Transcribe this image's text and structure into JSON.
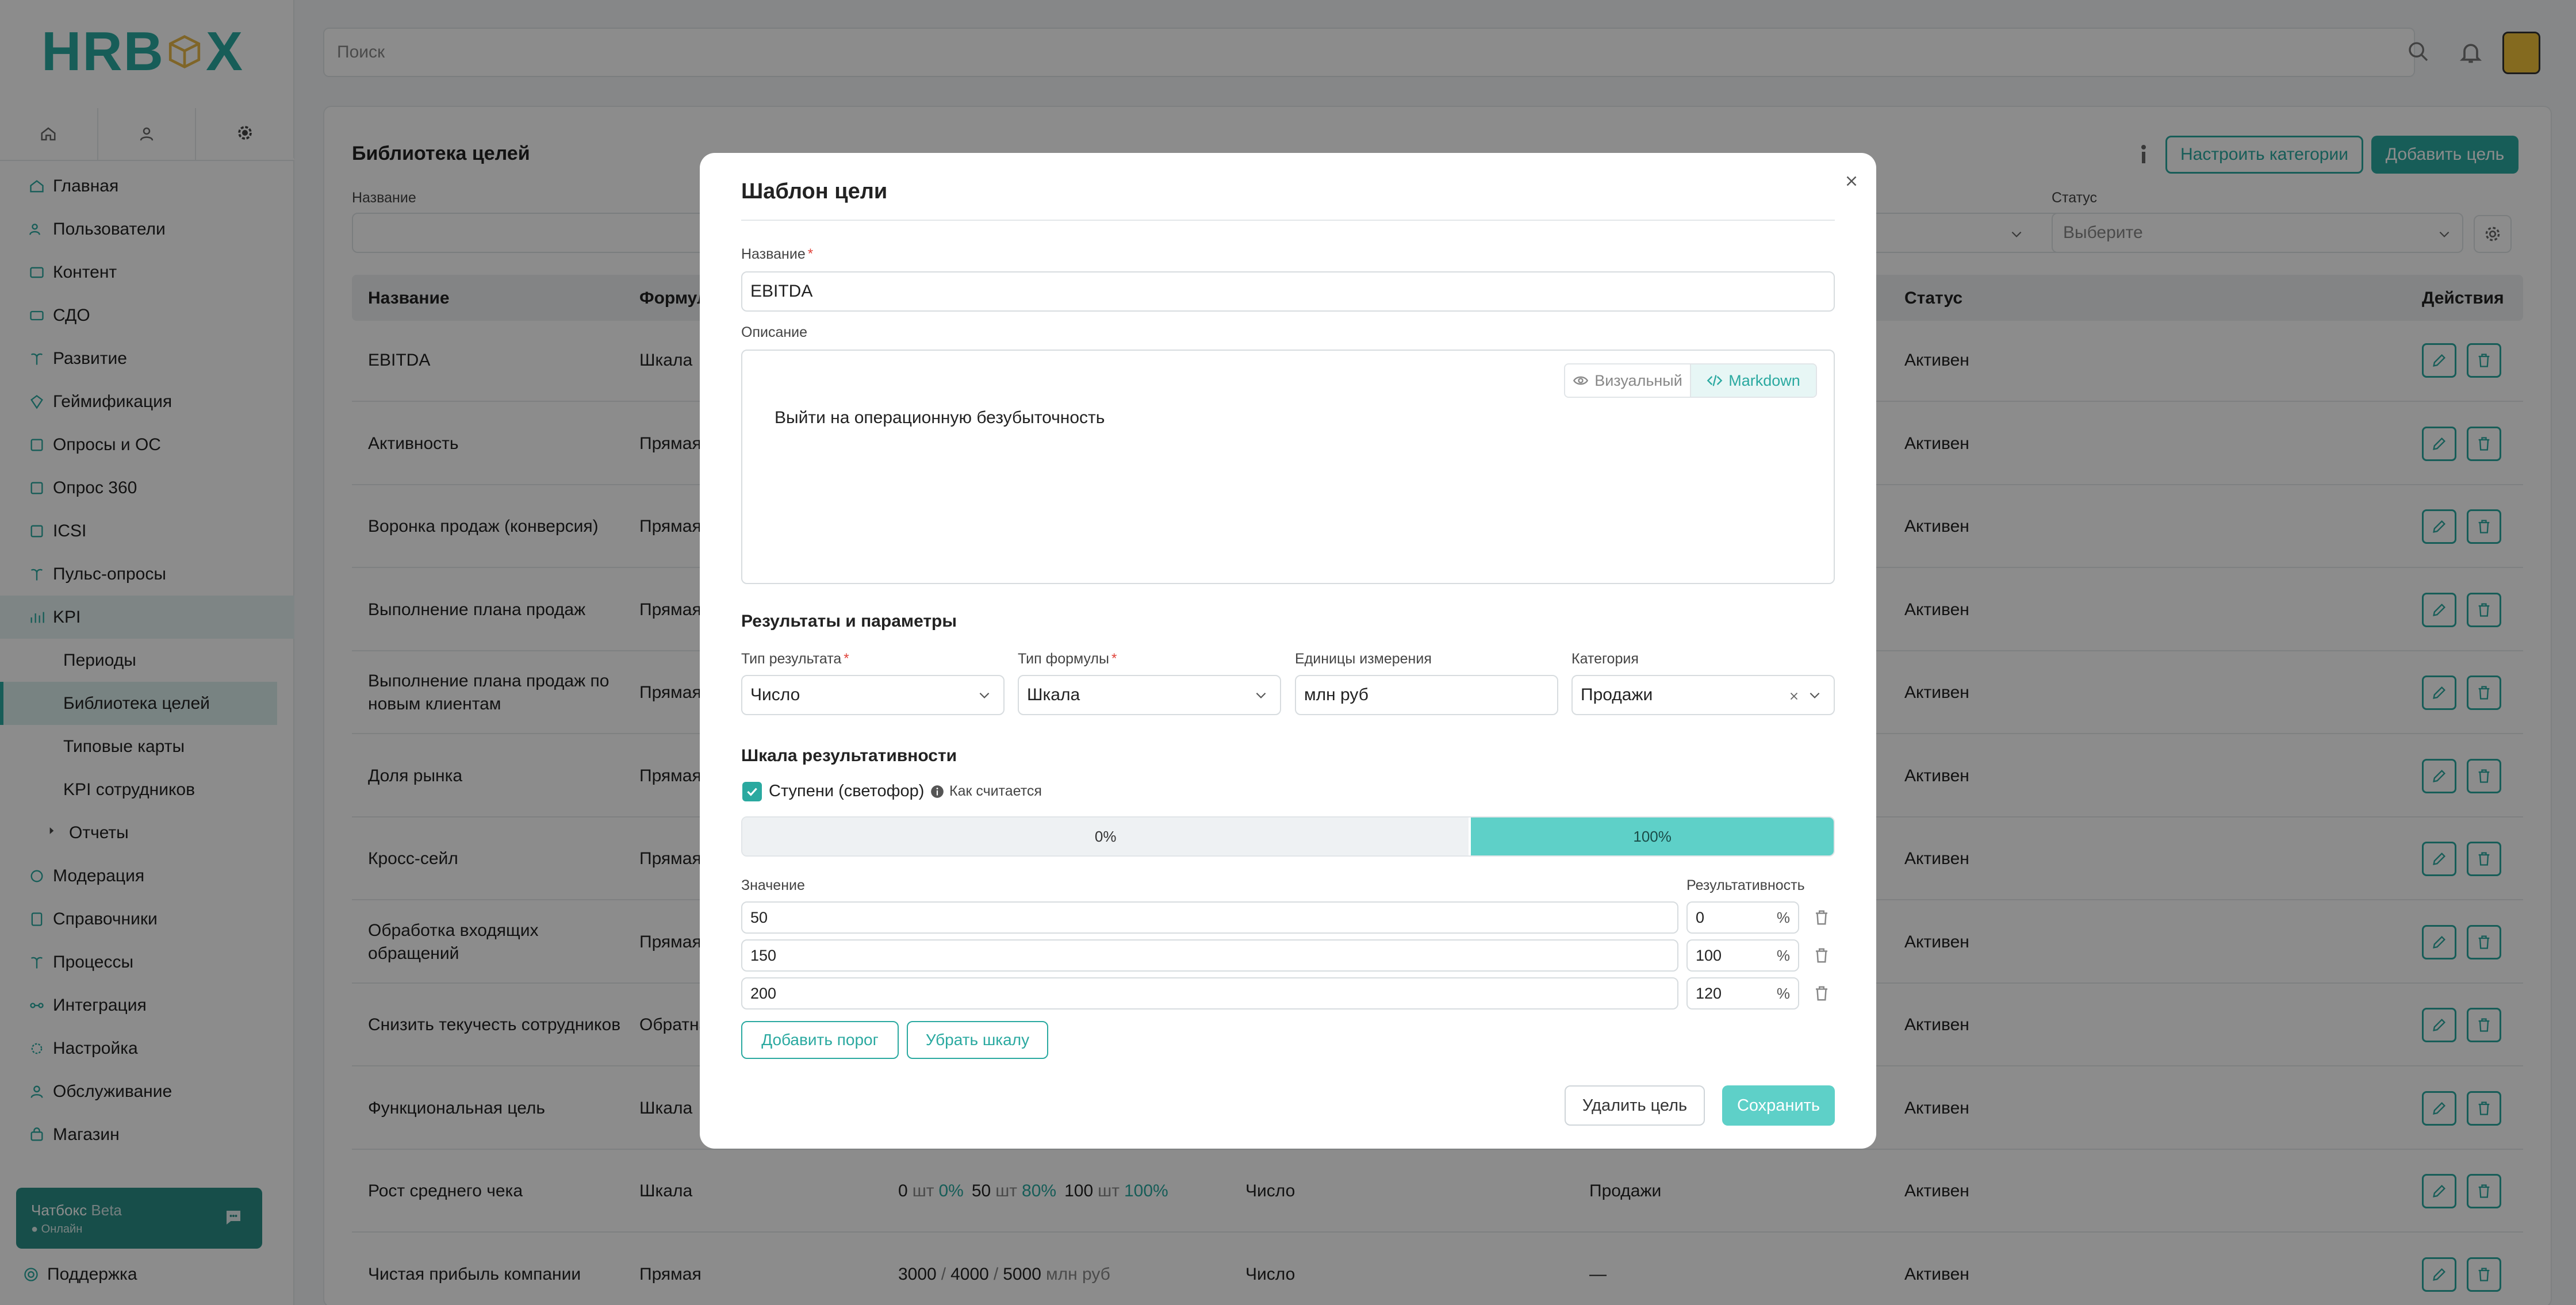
{
  "brand": {
    "part1": "HR",
    "part2": "B",
    "part3": "X"
  },
  "search": {
    "placeholder": "Поиск"
  },
  "sidebar": {
    "items": [
      {
        "label": "Главная",
        "icon": "home-icon"
      },
      {
        "label": "Пользователи",
        "icon": "users-icon"
      },
      {
        "label": "Контент",
        "icon": "content-icon"
      },
      {
        "label": "СДО",
        "icon": "lms-icon"
      },
      {
        "label": "Развитие",
        "icon": "growth-icon"
      },
      {
        "label": "Геймификация",
        "icon": "gamification-icon"
      },
      {
        "label": "Опросы и ОС",
        "icon": "survey-icon"
      },
      {
        "label": "Опрос 360",
        "icon": "survey360-icon"
      },
      {
        "label": "ICSI",
        "icon": "icsi-icon"
      },
      {
        "label": "Пульс-опросы",
        "icon": "pulse-icon"
      },
      {
        "label": "KPI",
        "icon": "kpi-icon"
      },
      {
        "label": "Периоды"
      },
      {
        "label": "Библиотека целей"
      },
      {
        "label": "Типовые карты"
      },
      {
        "label": "KPI сотрудников"
      },
      {
        "label": "Отчеты"
      },
      {
        "label": "Модерация",
        "icon": "moderation-icon"
      },
      {
        "label": "Справочники",
        "icon": "directory-icon"
      },
      {
        "label": "Процессы",
        "icon": "process-icon"
      },
      {
        "label": "Интеграция",
        "icon": "integration-icon"
      },
      {
        "label": "Настройка",
        "icon": "settings-icon"
      },
      {
        "label": "Обслуживание",
        "icon": "service-icon"
      },
      {
        "label": "Магазин",
        "icon": "shop-icon"
      }
    ],
    "chat_title": "Чатбокс",
    "chat_beta": "Beta",
    "chat_status": "● Онлайн",
    "support": "Поддержка"
  },
  "page": {
    "title": "Библиотека целей",
    "configure_categories": "Настроить категории",
    "add_goal": "Добавить цель",
    "filter_name_label": "Название",
    "filter_status_label": "Статус",
    "filter_status_placeholder": "Выберите"
  },
  "table": {
    "headers": {
      "name": "Название",
      "formula": "Формул",
      "status": "Статус",
      "actions": "Действия"
    },
    "rows": [
      {
        "name": "EBITDA",
        "formula": "Шкала",
        "status": "Активен"
      },
      {
        "name": "Активность",
        "formula": "Прямая",
        "status": "Активен"
      },
      {
        "name": "Воронка продаж (конверсия)",
        "formula": "Прямая",
        "status": "Активен"
      },
      {
        "name": "Выполнение плана продаж",
        "formula": "Прямая",
        "status": "Активен"
      },
      {
        "name": "Выполнение плана продаж по новым клиентам",
        "formula": "Прямая",
        "status": "Активен"
      },
      {
        "name": "Доля рынка",
        "formula": "Прямая",
        "status": "Активен"
      },
      {
        "name": "Кросс-сейл",
        "formula": "Прямая",
        "status": "Активен"
      },
      {
        "name": "Обработка входящих обращений",
        "formula": "Прямая",
        "status": "Активен"
      },
      {
        "name": "Снизить текучесть сотрудников",
        "formula": "Обратна",
        "status": "Активен"
      },
      {
        "name": "Функциональная цель",
        "formula": "Шкала",
        "status": "Активен"
      },
      {
        "name": "Рост среднего чека",
        "formula": "Шкала",
        "scale": [
          "0",
          "шт",
          "0%",
          "50",
          "шт",
          "80%",
          "100",
          "шт",
          "100%"
        ],
        "type": "Число",
        "category": "Продажи",
        "status": "Активен"
      },
      {
        "name": "Чистая прибыль компании",
        "formula": "Прямая",
        "scale": [
          "3000",
          "/",
          "4000",
          "/",
          "5000",
          "млн руб"
        ],
        "type": "Число",
        "category": "—",
        "status": "Активен"
      }
    ]
  },
  "modal": {
    "title": "Шаблон цели",
    "name_label": "Название",
    "name_value": "EBITDA",
    "desc_label": "Описание",
    "mode_visual": "Визуальный",
    "mode_markdown": "Markdown",
    "desc_value": "Выйти на операционную безубыточность",
    "results_section": "Результаты и параметры",
    "result_type_label": "Тип результата",
    "result_type_value": "Число",
    "formula_type_label": "Тип формулы",
    "formula_type_value": "Шкала",
    "units_label": "Единицы измерения",
    "units_value": "млн руб",
    "category_label": "Категория",
    "category_value": "Продажи",
    "scale_section": "Шкала результативности",
    "steps_label": "Ступени (светофор)",
    "how_label": "Как считается",
    "scale_segments": [
      {
        "label": "0%",
        "fraction": 0.667
      },
      {
        "label": "100%",
        "fraction": 0.333
      }
    ],
    "value_col": "Значение",
    "perf_col": "Результативность",
    "thresholds": [
      {
        "value": "50",
        "perf": "0"
      },
      {
        "value": "150",
        "perf": "100"
      },
      {
        "value": "200",
        "perf": "120"
      }
    ],
    "pct_sign": "%",
    "add_threshold": "Добавить порог",
    "remove_scale": "Убрать шкалу",
    "delete_goal": "Удалить цель",
    "save": "Сохранить"
  },
  "colors": {
    "accent": "#2aa9a0",
    "scale_fill": "#5ed0c8",
    "required": "#e0433a"
  }
}
